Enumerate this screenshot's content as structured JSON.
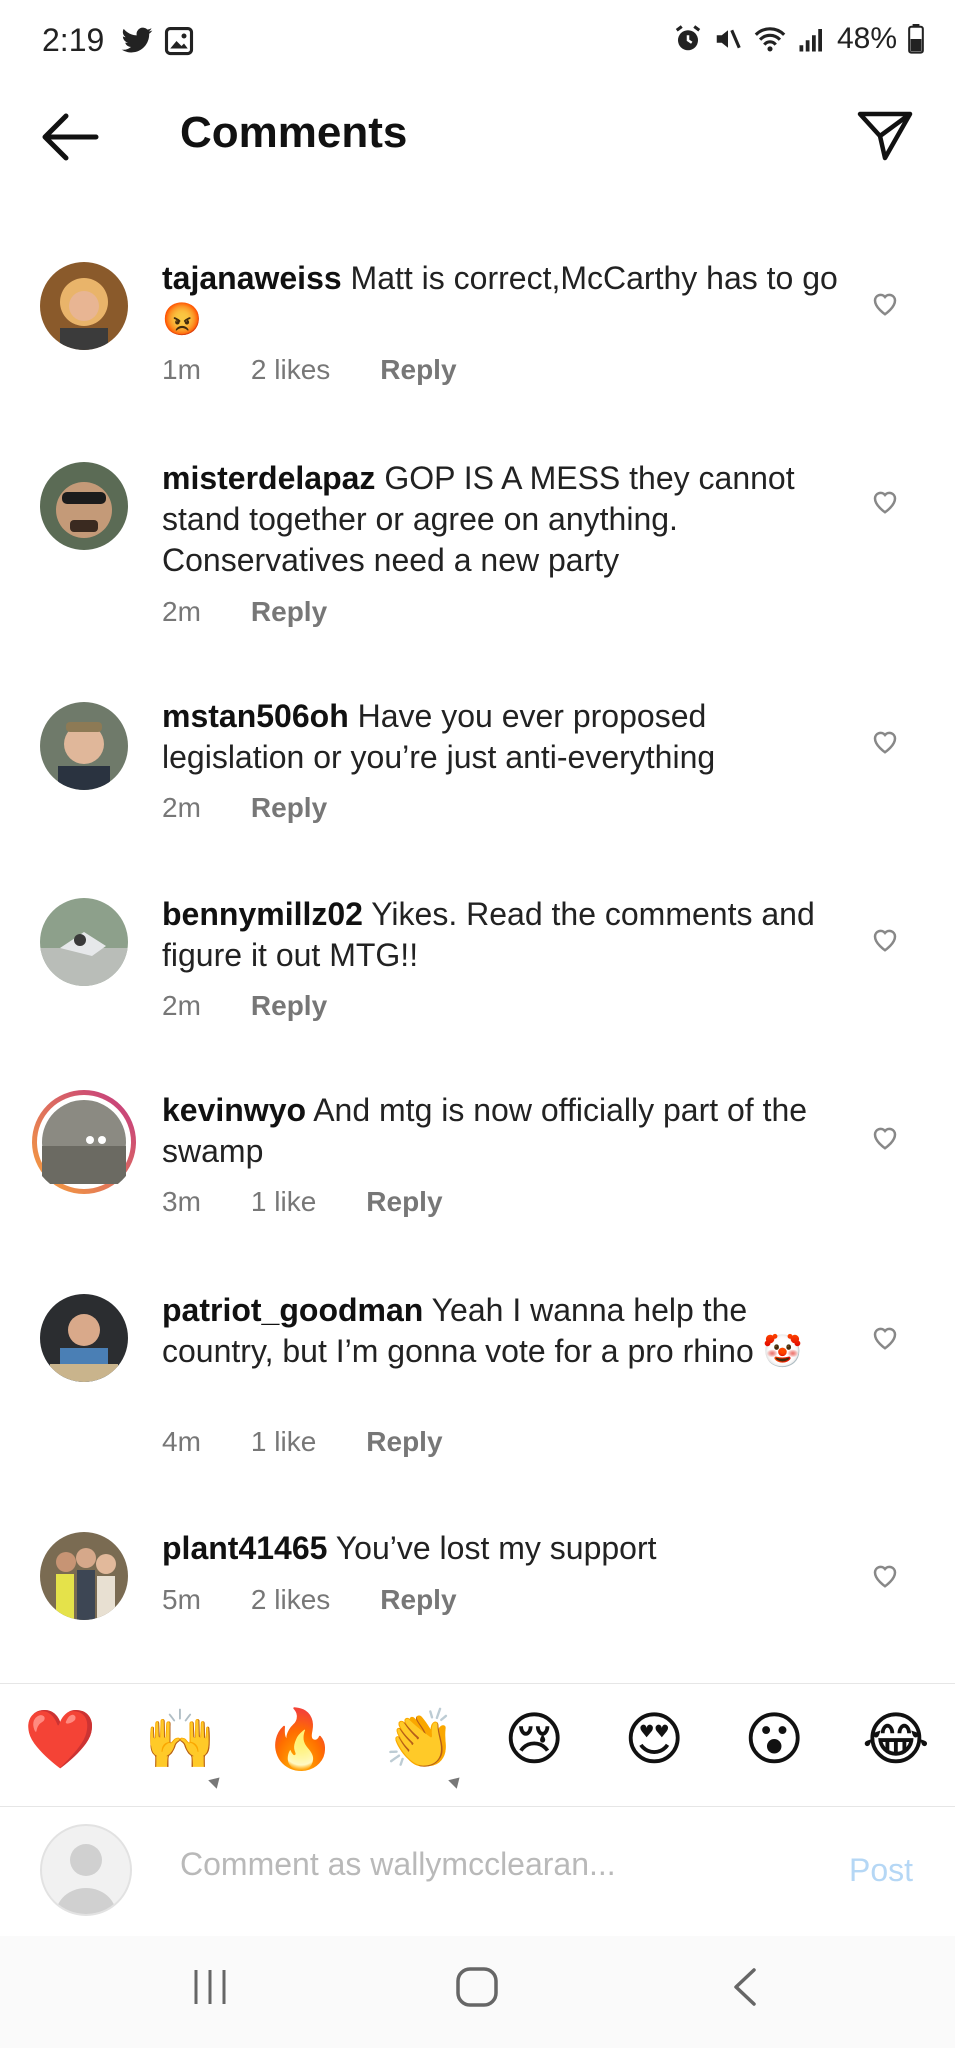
{
  "status_bar": {
    "time": "2:19",
    "battery": "48%"
  },
  "header": {
    "title": "Comments"
  },
  "comments": [
    {
      "username": "tajanaweiss",
      "text": "Matt is correct,McCarthy has to go 😡",
      "time": "1m",
      "likes": "2 likes",
      "reply": "Reply"
    },
    {
      "username": "misterdelapaz",
      "text": "GOP IS A MESS they cannot stand together or agree on anything. Conservatives need a new party",
      "time": "2m",
      "likes": "",
      "reply": "Reply"
    },
    {
      "username": "mstan506oh",
      "text": "Have you ever proposed legislation or you’re just anti-everything",
      "time": "2m",
      "likes": "",
      "reply": "Reply"
    },
    {
      "username": "bennymillz02",
      "text": "Yikes. Read the comments and figure it out MTG!!",
      "time": "2m",
      "likes": "",
      "reply": "Reply"
    },
    {
      "username": "kevinwyo",
      "text": "And mtg is now officially part of the swamp",
      "time": "3m",
      "likes": "1 like",
      "reply": "Reply"
    },
    {
      "username": "patriot_goodman",
      "text": "Yeah I wanna help the country, but I’m gonna vote for a pro rhino 🤡",
      "time": "4m",
      "likes": "1 like",
      "reply": "Reply"
    },
    {
      "username": "plant41465",
      "text": "You’ve lost my support",
      "time": "5m",
      "likes": "2 likes",
      "reply": "Reply"
    }
  ],
  "emoji_bar": [
    "❤️",
    "🙌",
    "🔥",
    "👏",
    "😢",
    "😍",
    "😮",
    "😂"
  ],
  "composer": {
    "placeholder": "Comment as wallymcclearan...",
    "post_label": "Post"
  },
  "colors": {
    "heart_red": "#e8222e",
    "post_disabled": "#b5d7f5",
    "meta_grey": "#777777",
    "story_ring_start": "#f9a53a",
    "story_ring_end": "#c13584"
  }
}
